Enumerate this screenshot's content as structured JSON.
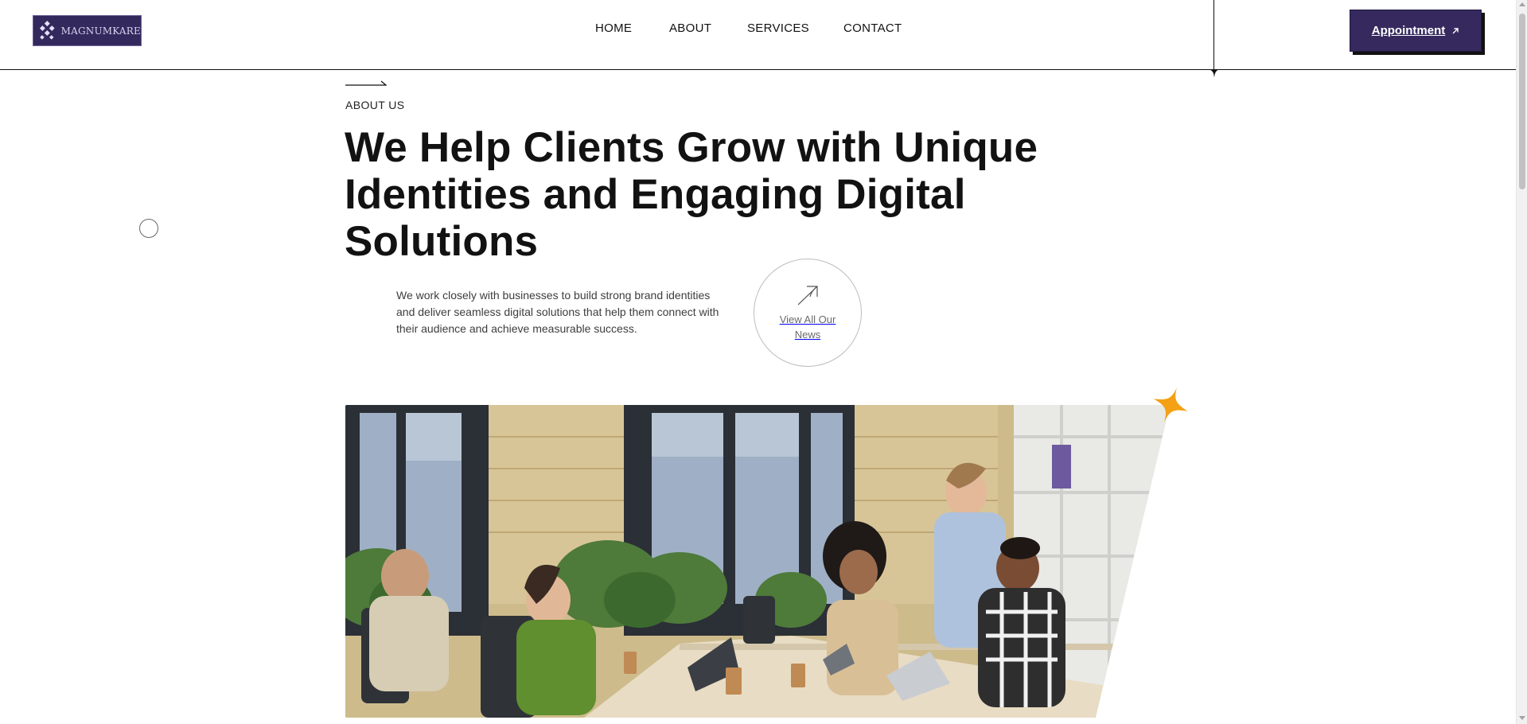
{
  "header": {
    "logo_text": "MAGNUMKARE",
    "nav": {
      "home": "HOME",
      "about": "ABOUT",
      "services": "SERVICES",
      "contact": "CONTACT"
    },
    "appointment_label": "Appointment",
    "appointment_icon": "arrow-up-right-icon"
  },
  "about": {
    "eyebrow": "ABOUT US",
    "heading_line1": "We Help Clients Grow with Unique",
    "heading_line2": "Identities and Engaging Digital Solutions",
    "description": "We work closely with businesses to build strong brand identities and deliver seamless digital solutions that help them connect with their audience and achieve measurable success.",
    "news_button_label": "View All Our News",
    "news_button_icon": "arrow-up-right-icon"
  },
  "colors": {
    "brand_purple": "#35295e",
    "accent_orange": "#f4a115",
    "text_dark": "#121212"
  },
  "image": {
    "subject": "team-meeting-photo"
  }
}
